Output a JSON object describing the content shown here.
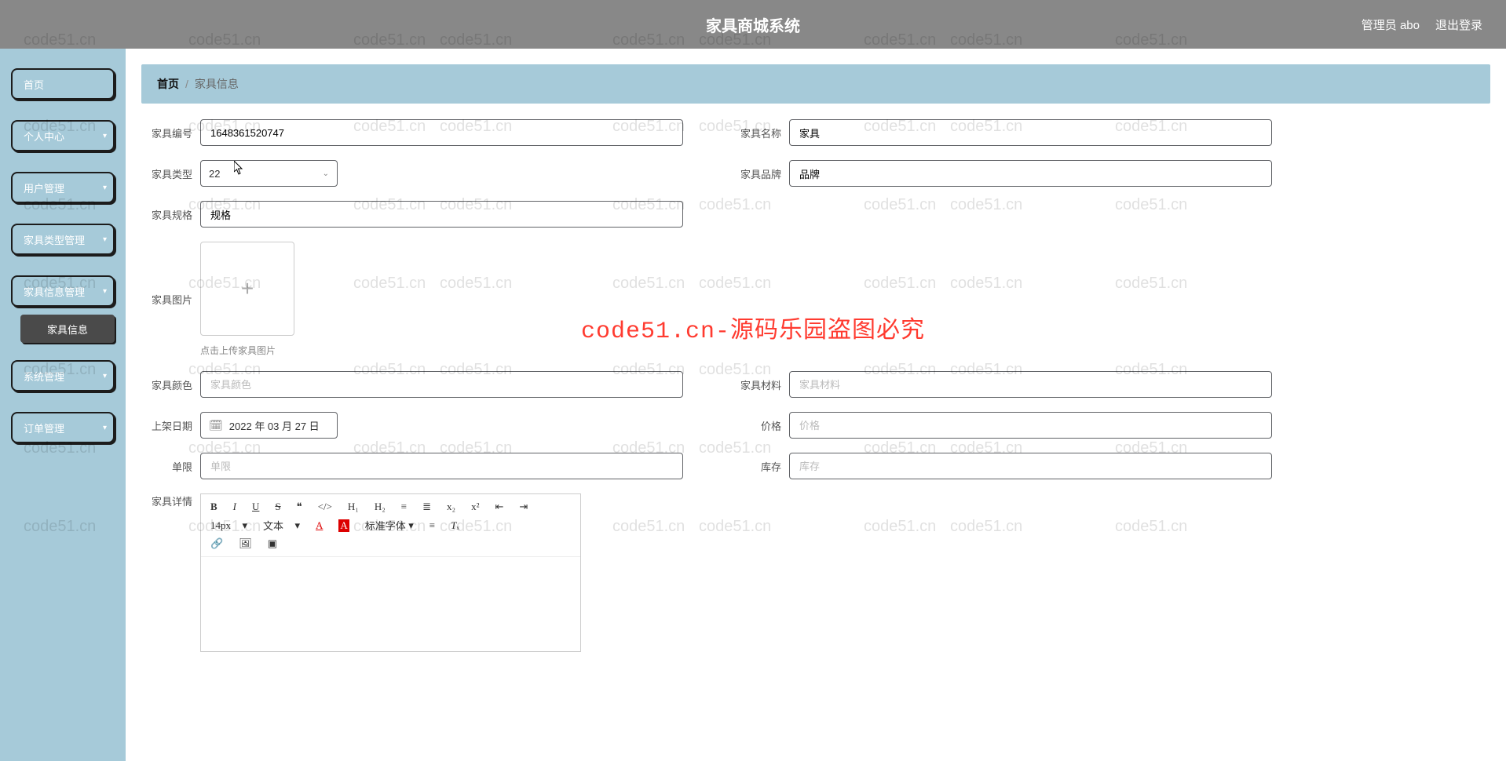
{
  "header": {
    "title": "家具商城系统",
    "user_label": "管理员 abo",
    "logout": "退出登录"
  },
  "sidebar": {
    "items": [
      {
        "label": "首页",
        "expandable": false
      },
      {
        "label": "个人中心",
        "expandable": true
      },
      {
        "label": "用户管理",
        "expandable": true
      },
      {
        "label": "家具类型管理",
        "expandable": true
      },
      {
        "label": "家具信息管理",
        "expandable": true
      },
      {
        "label": "系统管理",
        "expandable": true
      },
      {
        "label": "订单管理",
        "expandable": true
      }
    ],
    "sub_active": "家具信息"
  },
  "breadcrumb": {
    "home": "首页",
    "current": "家具信息"
  },
  "form": {
    "code": {
      "label": "家具编号",
      "value": "1648361520747"
    },
    "name": {
      "label": "家具名称",
      "value": "家具"
    },
    "type": {
      "label": "家具类型",
      "value": "22"
    },
    "brand": {
      "label": "家具品牌",
      "value": "品牌"
    },
    "spec": {
      "label": "家具规格",
      "value": "规格"
    },
    "image": {
      "label": "家具图片",
      "tip": "点击上传家具图片"
    },
    "color": {
      "label": "家具颜色",
      "placeholder": "家具颜色",
      "value": ""
    },
    "material": {
      "label": "家具材料",
      "placeholder": "家具材料",
      "value": ""
    },
    "date": {
      "label": "上架日期",
      "value": "2022 年 03 月 27 日"
    },
    "price": {
      "label": "价格",
      "placeholder": "价格",
      "value": ""
    },
    "limit": {
      "label": "单限",
      "placeholder": "单限",
      "value": ""
    },
    "stock": {
      "label": "库存",
      "placeholder": "库存",
      "value": ""
    },
    "detail": {
      "label": "家具详情"
    }
  },
  "editor": {
    "fontsize": "14px",
    "textlabel": "文本",
    "fontfamily": "标准字体"
  },
  "watermark": {
    "repeat": "code51.cn",
    "big": "code51.cn-源码乐园盗图必究"
  }
}
